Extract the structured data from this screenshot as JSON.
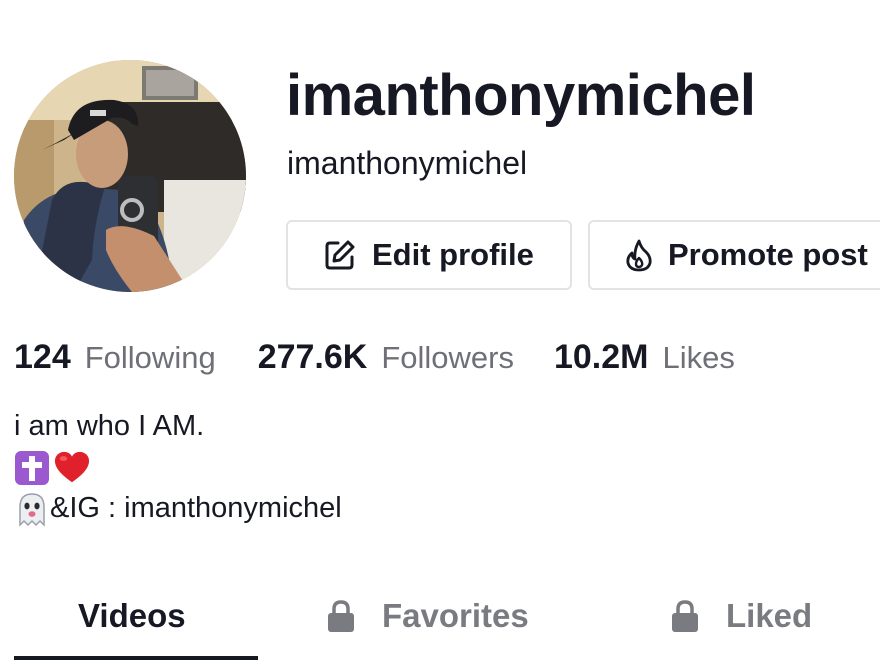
{
  "profile": {
    "username": "imanthonymichel",
    "nickname": "imanthonymichel"
  },
  "buttons": {
    "edit_profile": "Edit profile",
    "promote_post": "Promote post",
    "edit_icon": "edit-pencil-icon",
    "promote_icon": "flame-icon"
  },
  "stats": {
    "following": {
      "value": "124",
      "label": "Following"
    },
    "followers": {
      "value": "277.6K",
      "label": "Followers"
    },
    "likes": {
      "value": "10.2M",
      "label": "Likes"
    }
  },
  "bio": {
    "line1": "i am who I AM.",
    "line2_emojis": [
      "latin-cross-emoji",
      "red-heart-emoji"
    ],
    "line3_emoji": "ghost-emoji",
    "line3_text": "&IG : imanthonymichel"
  },
  "tabs": [
    {
      "label": "Videos",
      "selected": true,
      "locked": false
    },
    {
      "label": "Favorites",
      "selected": false,
      "locked": true
    },
    {
      "label": "Liked",
      "selected": false,
      "locked": true
    }
  ],
  "colors": {
    "text_primary": "#161823",
    "text_secondary": "#6f7077",
    "button_border": "#e3e3e4",
    "cross_emoji_bg": "#9b59d0",
    "heart_emoji": "#e0202a"
  }
}
